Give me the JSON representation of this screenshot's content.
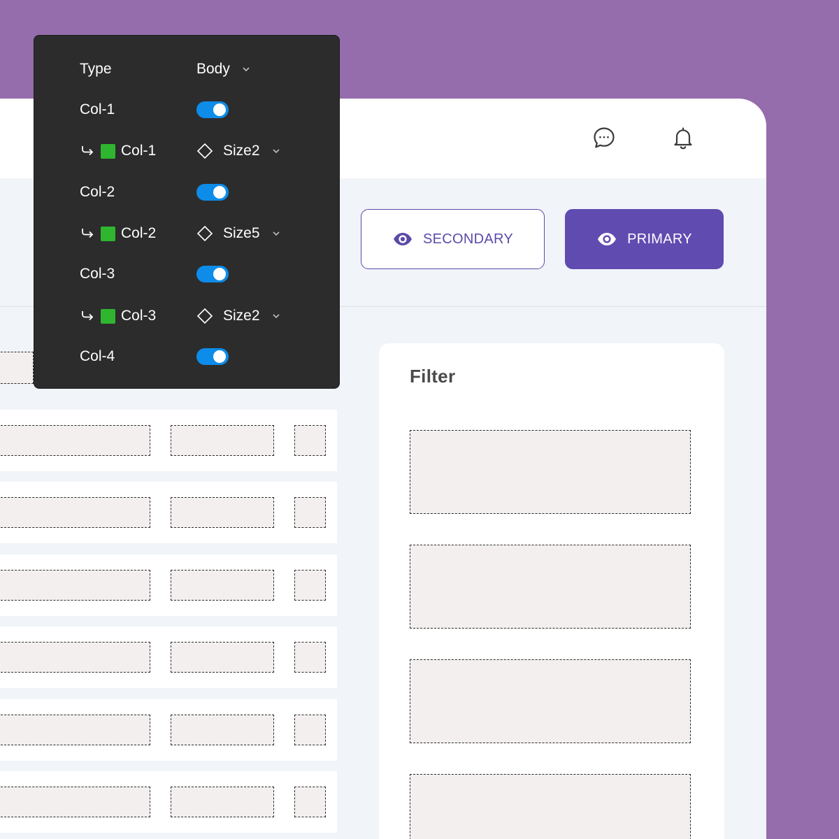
{
  "colors": {
    "background": "#956dac",
    "accent": "#604bb0",
    "toggle_on": "#0d8ce9",
    "panel": "#2c2c2c",
    "swatch": "#2fb52f"
  },
  "header": {
    "icons": [
      "chat-icon",
      "bell-icon"
    ]
  },
  "actions": {
    "secondary_label": "SECONDARY",
    "primary_label": "PRIMARY",
    "icon": "eye-icon"
  },
  "filter": {
    "title": "Filter"
  },
  "properties": {
    "type_label": "Type",
    "type_value": "Body",
    "rows": [
      {
        "label": "Col-1",
        "toggle": true
      },
      {
        "label": "Col-1",
        "size": "Size2"
      },
      {
        "label": "Col-2",
        "toggle": true
      },
      {
        "label": "Col-2",
        "size": "Size5"
      },
      {
        "label": "Col-3",
        "toggle": true
      },
      {
        "label": "Col-3",
        "size": "Size2"
      },
      {
        "label": "Col-4",
        "toggle": true
      }
    ]
  }
}
